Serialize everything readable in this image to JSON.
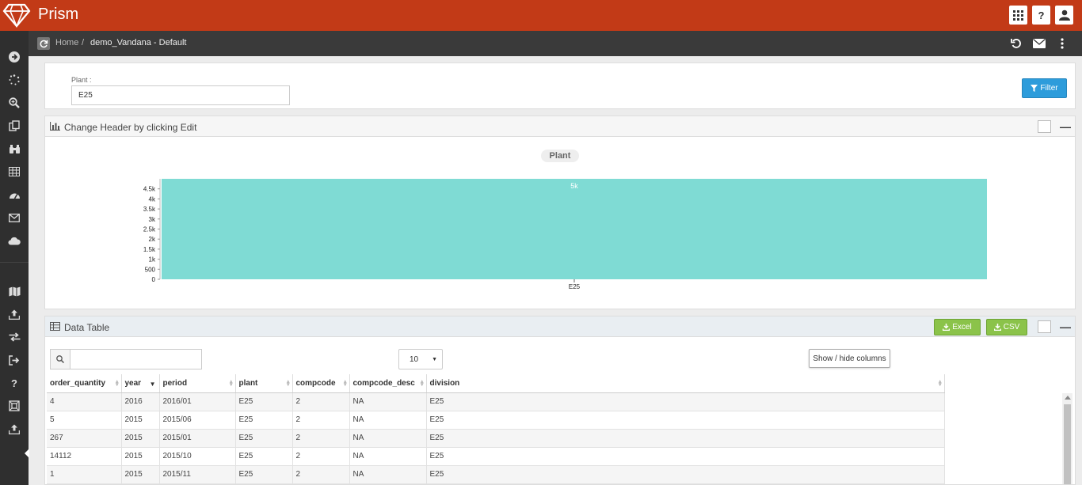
{
  "app": {
    "title": "Prism"
  },
  "topbar": {
    "apps_icon": "grid-icon",
    "help_label": "?",
    "user_icon": "user-icon"
  },
  "breadcrumb": {
    "home": "Home",
    "separator": "/",
    "current": "demo_Vandana - Default"
  },
  "sidebar": {
    "icons": [
      "arrow-right-circle-icon",
      "spinner-icon",
      "search-plus-icon",
      "copy-icon",
      "binoculars-icon",
      "table-icon",
      "dashboard-icon",
      "envelope-icon",
      "cloud-icon",
      "map-icon",
      "upload-icon",
      "exchange-icon",
      "sign-out-icon",
      "question-icon",
      "crop-icon",
      "upload-icon"
    ]
  },
  "filter": {
    "label": "Plant :",
    "value": "E25",
    "button_label": "Filter"
  },
  "chart_panel": {
    "title": "Change Header by clicking Edit"
  },
  "chart_data": {
    "type": "bar",
    "title": "Plant",
    "categories": [
      "E25"
    ],
    "values": [
      5000
    ],
    "data_labels": [
      "5k"
    ],
    "ylim": [
      0,
      5000
    ],
    "yticks": [
      "0",
      "500",
      "1k",
      "1.5k",
      "2k",
      "2.5k",
      "3k",
      "3.5k",
      "4k",
      "4.5k"
    ],
    "color": "#7fdbd4"
  },
  "table_panel": {
    "title": "Data Table",
    "excel_label": "Excel",
    "csv_label": "CSV",
    "page_length": "10",
    "colvis_label": "Show / hide columns",
    "columns": [
      "order_quantity",
      "year",
      "period",
      "plant",
      "compcode",
      "compcode_desc",
      "division"
    ],
    "rows": [
      [
        "4",
        "2016",
        "2016/01",
        "E25",
        "2",
        "NA",
        "E25"
      ],
      [
        "5",
        "2015",
        "2015/06",
        "E25",
        "2",
        "NA",
        "E25"
      ],
      [
        "267",
        "2015",
        "2015/01",
        "E25",
        "2",
        "NA",
        "E25"
      ],
      [
        "14112",
        "2015",
        "2015/10",
        "E25",
        "2",
        "NA",
        "E25"
      ],
      [
        "1",
        "2015",
        "2015/11",
        "E25",
        "2",
        "NA",
        "E25"
      ]
    ]
  },
  "colors": {
    "topbar": "#c23a17",
    "sidebar": "#2f2f2f",
    "accent": "#2d9cdb",
    "export": "#8bc34a"
  }
}
